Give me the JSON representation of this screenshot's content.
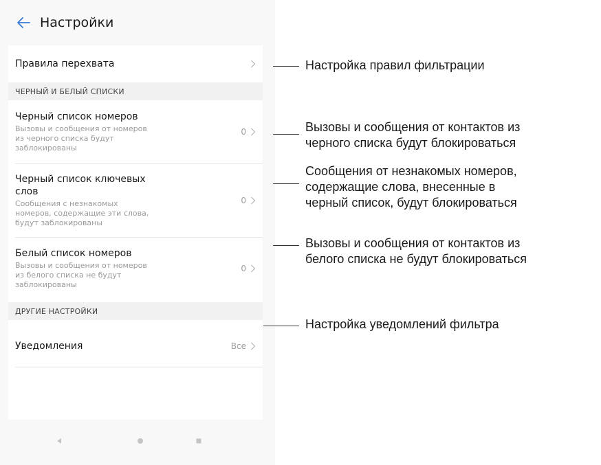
{
  "header": {
    "title": "Настройки",
    "back_icon": "arrow-left-icon",
    "accent": "#3a7bd5"
  },
  "rules_row": {
    "title": "Правила перехвата",
    "icon": "chevron-right-icon"
  },
  "section_lists": {
    "title": "ЧЕРНЫЙ И БЕЛЫЙ СПИСКИ"
  },
  "blacklist_numbers": {
    "title": "Черный список номеров",
    "subtitle_lines": [
      "Вызовы и сообщения от номеров",
      "из черного списка будут",
      "заблокированы"
    ],
    "count": "0"
  },
  "blacklist_keywords": {
    "title_lines": [
      "Черный список ключевых",
      "слов"
    ],
    "subtitle_lines": [
      "Сообщения с незнакомых",
      "номеров, содержащие эти слова,",
      "будут заблокированы"
    ],
    "count": "0"
  },
  "whitelist_numbers": {
    "title": "Белый список номеров",
    "subtitle_lines": [
      "Вызовы и сообщения от номеров",
      "из белого списка не будут",
      "заблокированы"
    ],
    "count": "0"
  },
  "section_other": {
    "title": "ДРУГИЕ НАСТРОЙКИ"
  },
  "notifications_row": {
    "title": "Уведомления",
    "value": "Все"
  },
  "navbar": {
    "back_icon": "triangle-back-icon",
    "home_icon": "circle-home-icon",
    "recents_icon": "square-recents-icon"
  },
  "callouts": {
    "rules": [
      "Настройка правил фильтрации"
    ],
    "blacklist_numbers": [
      "Вызовы и сообщения от контактов из",
      "черного списка будут блокироваться"
    ],
    "blacklist_keywords": [
      "Сообщения от незнакомых номеров,",
      "содержащие слова, внесенные в",
      "черный список, будут блокироваться"
    ],
    "whitelist_numbers": [
      "Вызовы и сообщения от контактов из",
      "белого списка не будут блокироваться"
    ],
    "notifications": [
      "Настройка уведомлений фильтра"
    ]
  }
}
